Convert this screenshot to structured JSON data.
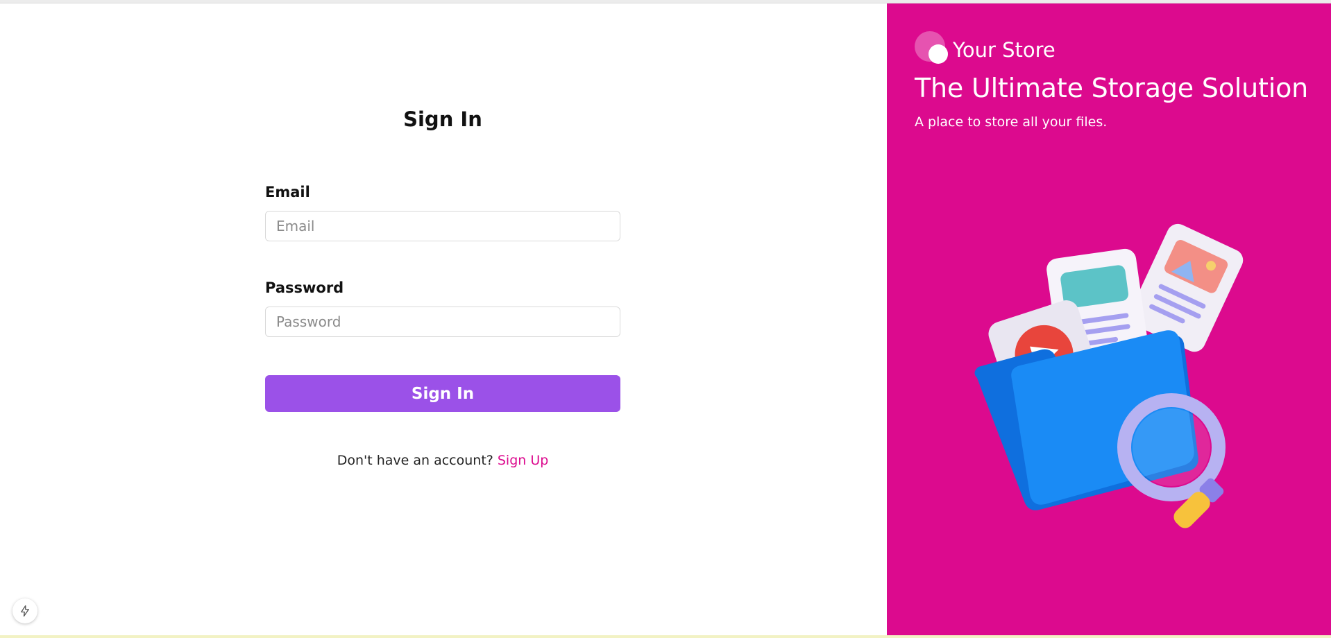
{
  "colors": {
    "accent_magenta": "#dc0a8e",
    "button_purple": "#9b51e8",
    "text_dark": "#111111"
  },
  "signin": {
    "title": "Sign In",
    "email_label": "Email",
    "email_placeholder": "Email",
    "email_value": "",
    "password_label": "Password",
    "password_placeholder": "Password",
    "password_value": "",
    "submit_label": "Sign In",
    "no_account_text": "Don't have an account?",
    "signup_link": "Sign Up"
  },
  "hero": {
    "brand_name": "Your Store",
    "headline": "The Ultimate Storage Solution",
    "tagline": "A place to store all your files.",
    "logo_icon": "brand-logo-circles",
    "illustration_icon": "folder-files-magnifier-illustration"
  },
  "dev_badge_icon": "lightning-bolt-icon"
}
